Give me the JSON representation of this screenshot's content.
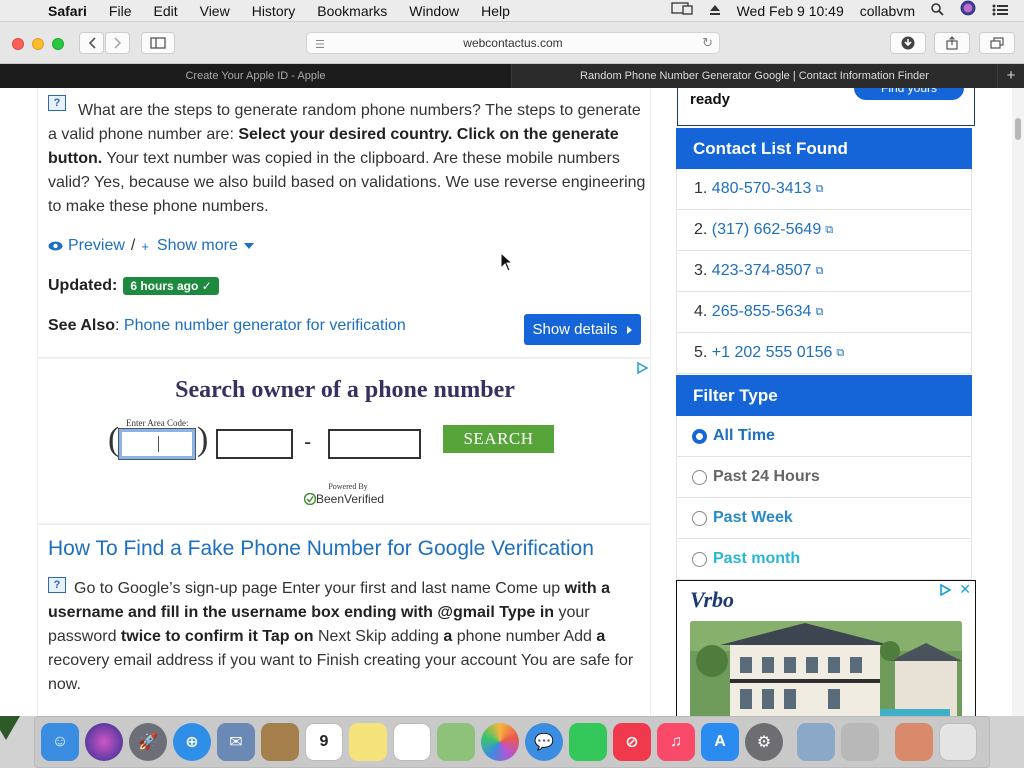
{
  "menubar": {
    "app": "Safari",
    "items": [
      "File",
      "Edit",
      "View",
      "History",
      "Bookmarks",
      "Window",
      "Help"
    ],
    "clock": "Wed Feb 9  10:49",
    "user": "collabvm"
  },
  "toolbar": {
    "url": "webcontactus.com"
  },
  "tabs": [
    {
      "label": "Create Your Apple ID - Apple"
    },
    {
      "label": "Random Phone Number Generator Google | Contact Information Finder"
    }
  ],
  "article1": {
    "q_icon": "?",
    "p1": "What are the steps to generate random phone numbers? The steps to generate a valid phone number are: ",
    "b1": "Select your desired country. Click on the generate button.",
    "p2": " Your text number was copied in the clipboard. Are these mobile numbers valid? Yes, because we also build based on validations. We use reverse engineering to make these phone numbers.",
    "preview": "Preview",
    "slash": "/",
    "show_more": "Show more",
    "updated_label": "Updated",
    "updated_badge": "6 hours ago",
    "see_also_label": "See Also",
    "see_also_link": "Phone number generator for verification",
    "show_details": "Show details"
  },
  "ad": {
    "title": "Search owner of a phone number",
    "area_label": "Enter Area Code:",
    "search": "SEARCH",
    "powered": "Powered By",
    "brand": "BeenVerified"
  },
  "article2": {
    "title": "How To Find a Fake Phone Number for Google Verification",
    "t1": "Go to Google’s sign-up page Enter your first and last name Come up ",
    "b1": "with a username and fill in the username box ending with @gmail Type in",
    "t2": " your password ",
    "b2": "twice to confirm it Tap on",
    "t3": " Next Skip adding ",
    "b3": "a",
    "t4": " phone number Add ",
    "b4": "a",
    "t5": " recovery email address if you want to Finish creating your account You are safe for now."
  },
  "sidebar": {
    "top_text": "ready",
    "top_button": "Find yours",
    "contacts_title": "Contact List Found",
    "contacts": [
      {
        "num": "1.",
        "phone": "480-570-3413"
      },
      {
        "num": "2.",
        "phone": "(317) 662-5649"
      },
      {
        "num": "3.",
        "phone": "423-374-8507"
      },
      {
        "num": "4.",
        "phone": "265-855-5634"
      },
      {
        "num": "5.",
        "phone": "+1 202 555 0156"
      }
    ],
    "filter_title": "Filter Type",
    "filters": [
      {
        "label": "All Time",
        "selected": true
      },
      {
        "label": "Past 24 Hours",
        "selected": false
      },
      {
        "label": "Past Week",
        "selected": false
      },
      {
        "label": "Past month",
        "selected": false
      }
    ],
    "ad_brand": "Vrbo"
  },
  "colors": {
    "accent": "#1665d8",
    "link": "#1d6fbf",
    "badge": "#1d8a3f",
    "search": "#56a43a"
  }
}
